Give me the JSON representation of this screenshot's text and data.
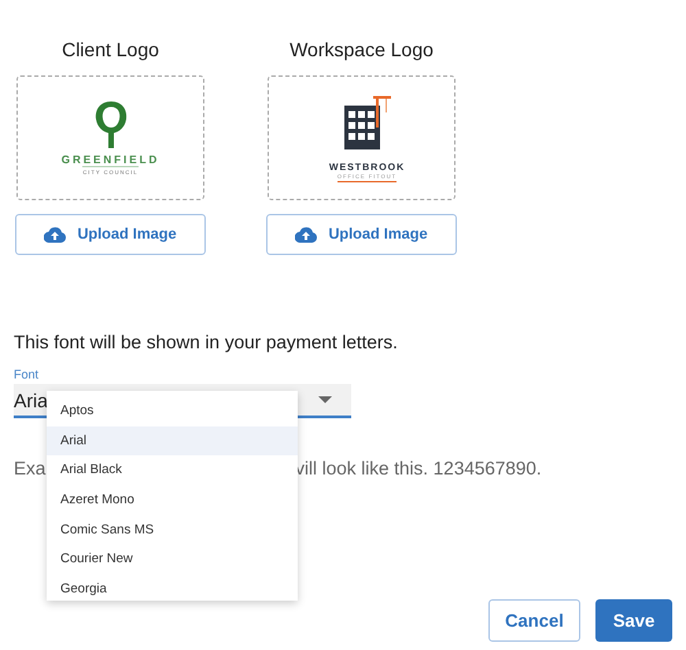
{
  "logos": [
    {
      "title": "Client Logo",
      "kind": "greenfield",
      "name": "GREENFIELD",
      "subtitle": "CITY COUNCIL",
      "button": "Upload Image"
    },
    {
      "title": "Workspace Logo",
      "kind": "westbrook",
      "name": "WESTBROOK",
      "subtitle": "OFFICE FITOUT",
      "button": "Upload Image"
    }
  ],
  "font_section": {
    "description": "This font will be shown in your payment letters.",
    "label": "Font",
    "value": "Aria",
    "sample_start": "Exa",
    "sample_end": "vill look like this. 1234567890."
  },
  "font_menu": [
    {
      "label": "Aptos",
      "selected": false
    },
    {
      "label": "Arial",
      "selected": true
    },
    {
      "label": "Arial Black",
      "selected": false
    },
    {
      "label": "Azeret Mono",
      "selected": false
    },
    {
      "label": "Comic Sans MS",
      "selected": false
    },
    {
      "label": "Courier New",
      "selected": false
    },
    {
      "label": "Georgia",
      "selected": false
    }
  ],
  "buttons": {
    "cancel": "Cancel",
    "save": "Save"
  }
}
